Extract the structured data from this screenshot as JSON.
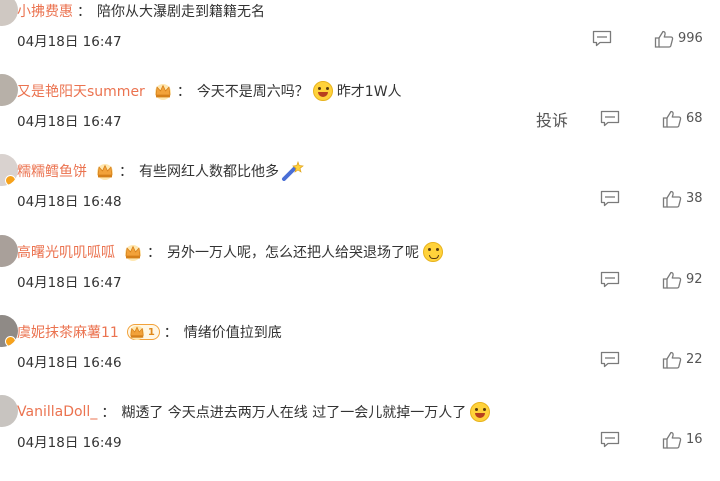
{
  "comments": [
    {
      "username": "小拂费惠",
      "colon": "：",
      "text": "陪你从大瀑剧走到籍籍无名",
      "time": "04月18日 16:47",
      "likes": "996"
    },
    {
      "username": "又是艳阳天summer",
      "colon": "：",
      "text_a": "今天不是周六吗？",
      "text_b": "昨才1W人",
      "time": "04月18日 16:47",
      "report": "投诉",
      "likes": "68"
    },
    {
      "username": "糯糯鳕鱼饼",
      "colon": "：",
      "text": "有些网红人数都比他多",
      "time": "04月18日 16:48",
      "likes": "38"
    },
    {
      "username": "高曙光叽叽呱呱",
      "colon": "：",
      "text": "另外一万人呢，怎么还把人给哭退场了呢",
      "time": "04月18日 16:47",
      "likes": "92"
    },
    {
      "username": "虞妮抹茶麻薯11",
      "badge_level": "1",
      "colon": "：",
      "text": "情绪价值拉到底",
      "time": "04月18日 16:46",
      "likes": "22"
    },
    {
      "username": "VanillaDoll_",
      "colon": "：",
      "text": "糊透了 今天点进去两万人在线 过了一会儿就掉一万人了",
      "time": "04月18日 16:49",
      "likes": "16"
    }
  ],
  "colors": {
    "username": "#eb7350",
    "text": "#333333",
    "icon": "#7a7a7a",
    "badge": "#f2a23a"
  },
  "icons": {
    "comment": "comment-icon",
    "like": "thumbs-up-icon",
    "crown": "crown-icon",
    "emoji_laugh": "laughing-emoji-icon",
    "emoji_cry": "crying-emoji-icon",
    "emoji_sparkle": "sparkle-emoji-icon"
  }
}
